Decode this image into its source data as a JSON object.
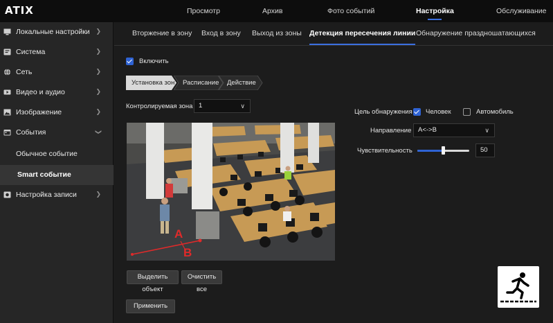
{
  "brand": {
    "logo_text": "ATIX"
  },
  "top_nav": [
    {
      "label": "Просмотр",
      "active": false
    },
    {
      "label": "Архив",
      "active": false
    },
    {
      "label": "Фото событий",
      "active": false
    },
    {
      "label": "Настройка",
      "active": true
    },
    {
      "label": "Обслуживание",
      "active": false
    }
  ],
  "sidebar": {
    "items": [
      {
        "label": "Локальные настройки",
        "icon": "monitor-icon",
        "chevron": "right"
      },
      {
        "label": "Система",
        "icon": "system-icon",
        "chevron": "right"
      },
      {
        "label": "Сеть",
        "icon": "globe-icon",
        "chevron": "right"
      },
      {
        "label": "Видео и аудио",
        "icon": "video-icon",
        "chevron": "right"
      },
      {
        "label": "Изображение",
        "icon": "image-icon",
        "chevron": "right"
      },
      {
        "label": "События",
        "icon": "calendar-icon",
        "chevron": "down"
      },
      {
        "label": "Обычное событие"
      },
      {
        "label": "Smart событие",
        "active": true
      },
      {
        "label": "Настройка записи",
        "icon": "record-icon",
        "chevron": "right"
      }
    ]
  },
  "subtabs": [
    {
      "label": "Вторжение в зону",
      "active": false
    },
    {
      "label": "Вход в зону",
      "active": false
    },
    {
      "label": "Выход из зоны",
      "active": false
    },
    {
      "label": "Детекция пересечения линии",
      "active": true
    },
    {
      "label": "Обнаружение праздношатающихся",
      "active": false
    }
  ],
  "enable": {
    "label": "Включить",
    "checked": true
  },
  "steps": [
    {
      "label": "Установка зон",
      "active": true
    },
    {
      "label": "Расписание",
      "active": false
    },
    {
      "label": "Действие",
      "active": false
    }
  ],
  "zone": {
    "label": "Контролируемая зона",
    "value": "1"
  },
  "target": {
    "label": "Цель обнаружения",
    "human_label": "Человек",
    "human_checked": true,
    "vehicle_label": "Автомобиль",
    "vehicle_checked": false
  },
  "direction": {
    "label": "Направление",
    "value": "A<->B"
  },
  "sensitivity": {
    "label": "Чувствительность",
    "value": "50",
    "level": 0.5
  },
  "video": {
    "line_label_a": "A",
    "line_label_b": "B"
  },
  "buttons": {
    "select_object": "Выделить объект",
    "clear_all": "Очистить все",
    "apply": "Применить"
  },
  "colors": {
    "accent": "#2f63d4",
    "line": "#e02a2a"
  }
}
